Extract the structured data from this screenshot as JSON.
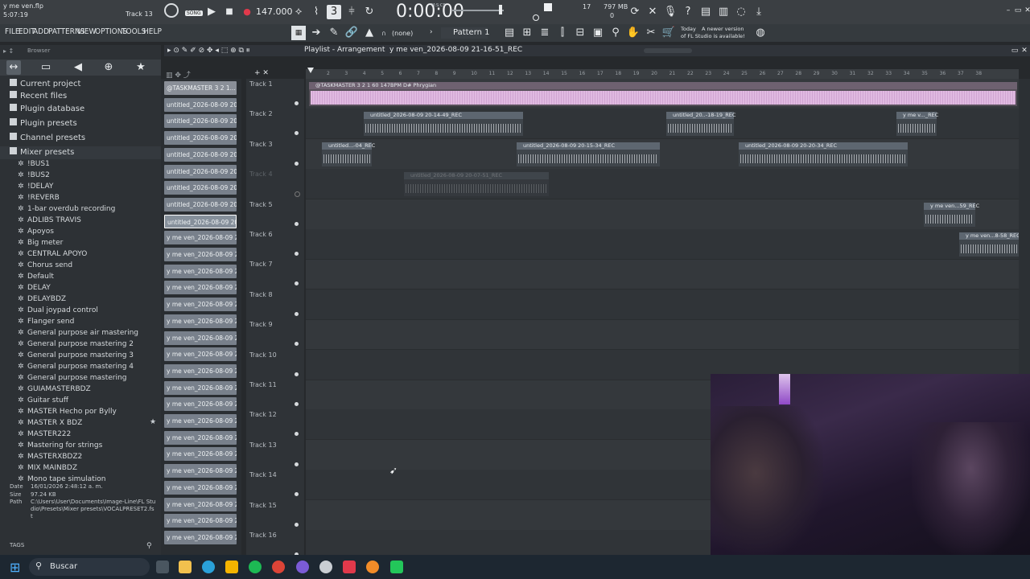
{
  "window": {
    "project_file": "y me ven.flp",
    "project_time": "5:07:19",
    "hint_track": "Track 13"
  },
  "transport": {
    "song_mode": "SONG",
    "tempo": "147.000",
    "time": "0:00:00",
    "time_unit": "M:S:CS",
    "cpu": "17",
    "memory": "797 MB",
    "poly": "0"
  },
  "menu": [
    "FILE",
    "EDIT",
    "ADD",
    "PATTERNS",
    "VIEW",
    "OPTIONS",
    "TOOLS",
    "HELP"
  ],
  "toolbar": {
    "snap": "(none)",
    "pattern": "Pattern 1",
    "news_title": "Today",
    "news_text": "A newer version of FL Studio is available!"
  },
  "browser": {
    "title": "Browser",
    "sections": [
      "Current project",
      "Recent files",
      "Plugin database",
      "Plugin presets",
      "Channel presets",
      "Mixer presets"
    ],
    "presets": [
      "!BUS1",
      "!BUS2",
      "!DELAY",
      "!REVERB",
      "1-bar overdub recording",
      "ADLIBS TRAVIS",
      "Apoyos",
      "Big meter",
      "CENTRAL APOYO",
      "Chorus send",
      "Default",
      "DELAY",
      "DELAYBDZ",
      "Dual joypad control",
      "Flanger send",
      "General purpose air mastering",
      "General purpose mastering 2",
      "General purpose mastering 3",
      "General purpose mastering 4",
      "General purpose mastering",
      "GUIAMASTERBDZ",
      "Guitar stuff",
      "MASTER Hecho por Bylly",
      "MASTER X BDZ",
      "MASTER222",
      "Mastering for strings",
      "MASTERXBDZ2",
      "MIX MAINBDZ",
      "Mono tape simulation"
    ]
  },
  "info_panel": {
    "date_label": "Date",
    "date": "16/01/2026 2:48:12 a. m.",
    "size_label": "Size",
    "size": "97.24 KB",
    "path_label": "Path",
    "path": "C:\\Users\\User\\Documents\\Image-Line\\FL Studio\\Presets\\Mixer presets\\VOCALPRESET2.fst",
    "tags_label": "TAGS"
  },
  "playlist": {
    "title": "Playlist - Arrangement",
    "current": "y me ven_2026-08-09 21-16-51_REC",
    "ticks": [
      "2",
      "3",
      "4",
      "5",
      "6",
      "7",
      "8",
      "9",
      "10",
      "11",
      "12",
      "13",
      "14",
      "15",
      "16",
      "17",
      "18",
      "19",
      "20",
      "21",
      "22",
      "23",
      "24",
      "25",
      "26",
      "27",
      "28",
      "29",
      "30",
      "31",
      "32",
      "33",
      "34",
      "35",
      "36",
      "37",
      "38"
    ],
    "tracks": [
      "Track 1",
      "Track 2",
      "Track 3",
      "Track 4",
      "Track 5",
      "Track 6",
      "Track 7",
      "Track 8",
      "Track 9",
      "Track 10",
      "Track 11",
      "Track 12",
      "Track 13",
      "Track 14",
      "Track 15",
      "Track 16"
    ],
    "clips": [
      {
        "track": 0,
        "label": "@TASKMASTER 3 2 1 60 147BPM D# Phrygian",
        "pink": true
      },
      {
        "track": 1,
        "label": "untitled_2026-08-09 20-14-49_REC"
      },
      {
        "track": 1,
        "label": "untitled_20..-18-19_REC"
      },
      {
        "track": 1,
        "label": "y me v..._REC"
      },
      {
        "track": 2,
        "label": "untitled...-04_REC"
      },
      {
        "track": 2,
        "label": "untitled_2026-08-09 20-15-34_REC"
      },
      {
        "track": 2,
        "label": "untitled_2026-08-09 20-20-34_REC"
      },
      {
        "track": 3,
        "label": "untitled_2026-08-09 20-07-51_REC"
      },
      {
        "track": 4,
        "label": "y me ven...59_REC"
      },
      {
        "track": 5,
        "label": "y me ven...8-58_REC"
      }
    ]
  },
  "patterns": [
    "@TASKMASTER 3 2 1...",
    "untitled_2026-08-09 20-...",
    "untitled_2026-08-09 20-...",
    "untitled_2026-08-09 20-...",
    "untitled_2026-08-09 20-...",
    "untitled_2026-08-09 20-...",
    "untitled_2026-08-09 20-...",
    "untitled_2026-08-09 20-...",
    "untitled_2026-08-09 20-...",
    "y me ven_2026-08-09 20...",
    "y me ven_2026-08-09 20...",
    "y me ven_2026-08-09 20...",
    "y me ven_2026-08-09 20...",
    "y me ven_2026-08-09 20...",
    "y me ven_2026-08-09 20...",
    "y me ven_2026-08-09 20...",
    "y me ven_2026-08-09 20...",
    "y me ven_2026-08-09 20...",
    "y me ven_2026-08-09 20...",
    "y me ven_2026-08-09 20...",
    "y me ven_2026-08-09 20...",
    "y me ven_2026-08-09 20...",
    "y me ven_2026-08-09 20...",
    "y me ven_2026-08-09 20...",
    "y me ven_2026-08-09 20...",
    "y me ven_2026-08-09 20...",
    "y me ven_2026-08-09 20...",
    "y me ven_2026-08-09 20..."
  ],
  "taskbar": {
    "search_placeholder": "Buscar"
  },
  "colors": {
    "accent_pink": "#e7c0e8",
    "record_red": "#e0394b",
    "panel": "#2d3135"
  }
}
